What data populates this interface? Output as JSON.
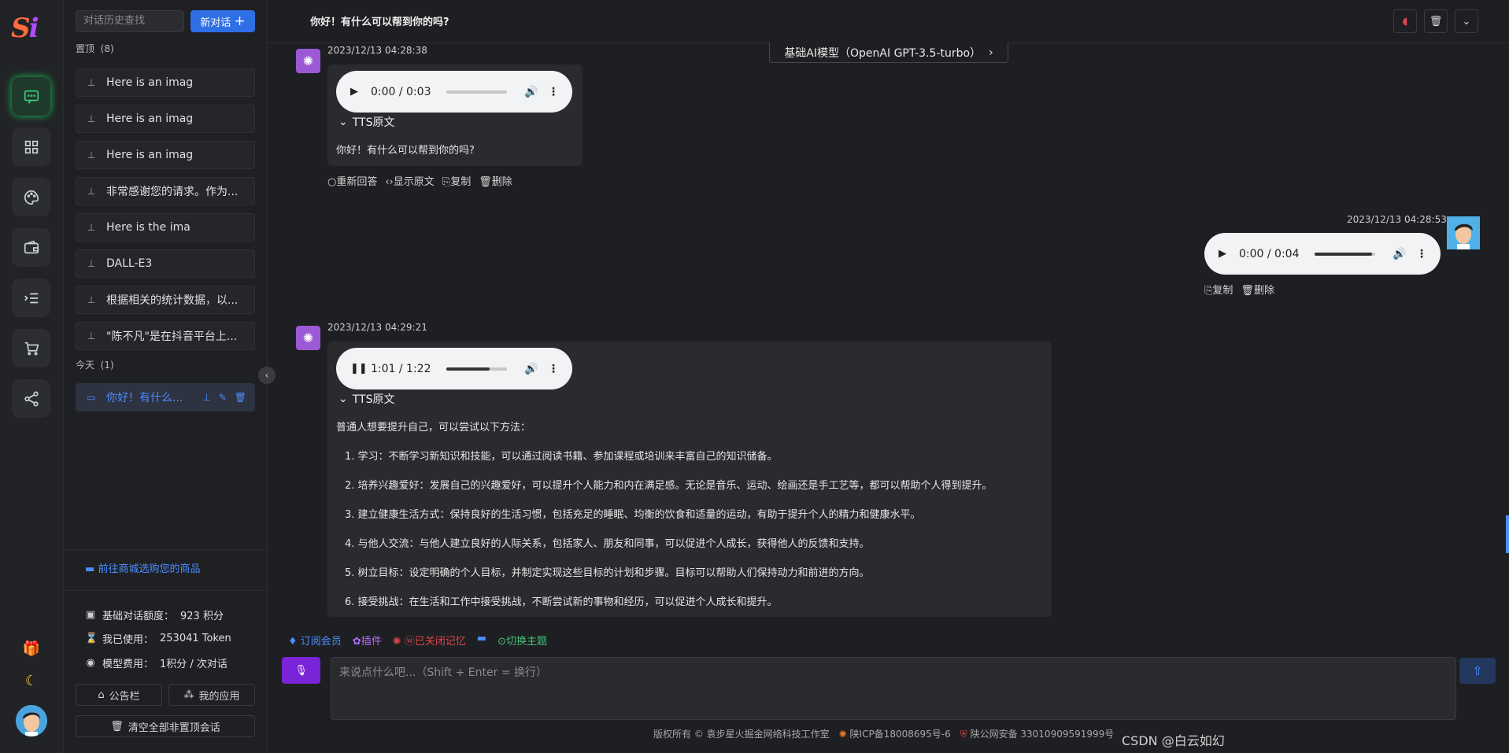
{
  "sidebar": {
    "search_placeholder": "对话历史查找",
    "new_chat_label": "新对话",
    "pinned_label": "置顶",
    "pinned_count": "(8)",
    "pinned_items": [
      "Here is an imag",
      "Here is an imag",
      "Here is an imag",
      "非常感谢您的请求。作为...",
      "Here is the ima",
      "DALL-E3",
      "根据相关的统计数据，以...",
      "\"陈不凡\"是在抖音平台上..."
    ],
    "today_label": "今天",
    "today_count": "(1)",
    "today_items": [
      "你好！有什么..."
    ],
    "shop_link": "前往商城选购您的商品",
    "stats": [
      {
        "label": "基础对话额度：",
        "value": "923 积分"
      },
      {
        "label": "我已使用：",
        "value": "253041 Token"
      },
      {
        "label": "模型费用：",
        "value": "1积分 / 次对话"
      }
    ],
    "notice_button": "公告栏",
    "my_apps_button": "我的应用",
    "clear_button": "清空全部非置顶会话"
  },
  "header": {
    "title": "你好！有什么可以帮到你的吗?",
    "model": "基础AI模型（OpenAI GPT-3.5-turbo）"
  },
  "messages": {
    "m1": {
      "time": "2023/12/13 04:28:38",
      "audio_time": "0:00 / 0:03",
      "audio_progress": 0,
      "tts_label": "TTS原文",
      "text": "你好！有什么可以帮到你的吗?",
      "actions": [
        "重新回答",
        "显示原文",
        "复制",
        "删除"
      ]
    },
    "m2": {
      "time": "2023/12/13 04:28:53",
      "audio_time": "0:00 / 0:04",
      "audio_progress": 0.95,
      "actions": [
        "复制",
        "删除"
      ]
    },
    "m3": {
      "time": "2023/12/13 04:29:21",
      "audio_time": "1:01 / 1:22",
      "audio_progress": 0.72,
      "tts_label": "TTS原文",
      "intro": "普通人想要提升自己，可以尝试以下方法：",
      "items": [
        "1. 学习：不断学习新知识和技能，可以通过阅读书籍、参加课程或培训来丰富自己的知识储备。",
        "2. 培养兴趣爱好：发展自己的兴趣爱好，可以提升个人能力和内在满足感。无论是音乐、运动、绘画还是手工艺等，都可以帮助个人得到提升。",
        "3. 建立健康生活方式：保持良好的生活习惯，包括充足的睡眠、均衡的饮食和适量的运动，有助于提升个人的精力和健康水平。",
        "4. 与他人交流：与他人建立良好的人际关系，包括家人、朋友和同事，可以促进个人成长，获得他人的反馈和支持。",
        "5. 树立目标：设定明确的个人目标，并制定实现这些目标的计划和步骤。目标可以帮助人们保持动力和前进的方向。",
        "6. 接受挑战：在生活和工作中接受挑战，不断尝试新的事物和经历，可以促进个人成长和提升。"
      ]
    }
  },
  "toolbar": {
    "subscribe": "订阅会员",
    "plugins": "插件",
    "memory": "已关闭记忆",
    "theme": "切换主题"
  },
  "input": {
    "placeholder": "来说点什么吧...（Shift + Enter = 换行）"
  },
  "footer": {
    "copyright": "版权所有 © 袁步星火掘金网络科技工作室",
    "icp": "陕ICP备18008695号-6",
    "police": "陕公网安备 33010909591999号"
  },
  "watermark": "CSDN @白云如幻"
}
